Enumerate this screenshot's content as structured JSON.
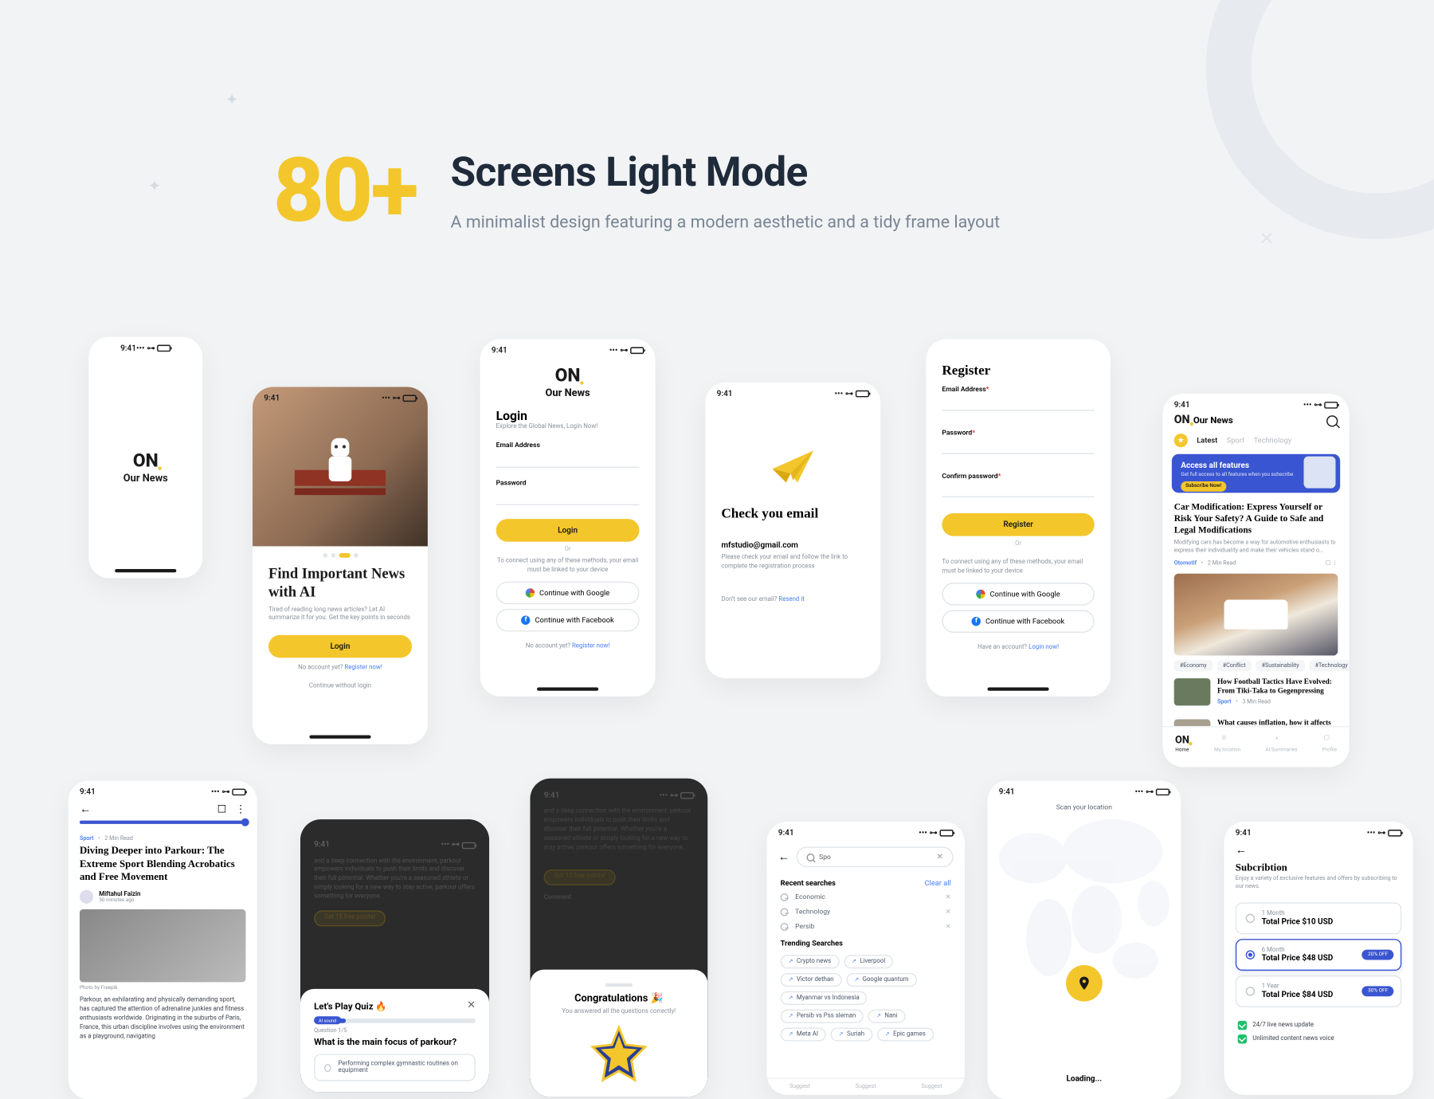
{
  "hero": {
    "number": "80+",
    "title": "Screens Light Mode",
    "subtitle": "A minimalist design featuring a modern aesthetic and a tidy frame layout"
  },
  "status_time": "9:41",
  "brand": {
    "logo": "ON",
    "name": "Our News"
  },
  "screen_onboarding": {
    "title": "Find Important News with AI",
    "desc": "Tired of reading long news articles? Let AI summarize it for you. Get the key points in seconds",
    "cta": "Login",
    "no_account": "No account yet? ",
    "register": "Register now!",
    "skip": "Continue without login"
  },
  "screen_login": {
    "title": "Login",
    "subtitle": "Explore the Global News, Login Now!",
    "email_label": "Email Address",
    "password_label": "Password",
    "cta": "Login",
    "or": "Or",
    "connect": "To connect using any of these methods, your email must be linked to your device",
    "google": "Continue with Google",
    "facebook": "Continue with Facebook",
    "no_account": "No account yet? ",
    "register": "Register now!"
  },
  "screen_check_email": {
    "title": "Check you email",
    "email": "mfstudio@gmail.com",
    "desc": "Please check your email and follow the link to complete the registration process",
    "no_email": "Don't see our email? ",
    "resend": "Resend it"
  },
  "screen_register": {
    "title": "Register",
    "email_label": "Email Address",
    "password_label": "Password",
    "confirm_label": "Confirm password",
    "cta": "Register",
    "or": "Or",
    "connect": "To connect using any of these methods, your email must be linked to your device",
    "google": "Continue with Google",
    "facebook": "Continue with Facebook",
    "have_account": "Have an account? ",
    "login": "Login now!"
  },
  "screen_home": {
    "tabs": [
      "Latest",
      "Sport",
      "Technology"
    ],
    "promo": {
      "title": "Access all features",
      "sub": "Get full access to all features when you subscribe",
      "cta": "Subscribe Now!"
    },
    "article1": {
      "title": "Car Modification: Express Yourself or Risk Your Safety? A Guide to Safe and Legal Modifications",
      "desc": "Modifying cars has become a way for automotive enthusiasts to express their individuality and make their vehicles stand o…",
      "cat": "Otomotif",
      "read": "2 Min Read"
    },
    "chips": [
      "#Economy",
      "#Conflict",
      "#Sustainability",
      "#Technology"
    ],
    "article2": {
      "title": "How Football Tactics Have Evolved: From Tiki-Taka to Gegenpressing",
      "cat": "Sport",
      "read": "3 Min Read"
    },
    "article3": {
      "title": "What causes inflation, how it affects the"
    },
    "nav": [
      "Home",
      "My location",
      "AI Summaries",
      "Profile"
    ]
  },
  "screen_article": {
    "cat": "Sport",
    "read": "2 Min Read",
    "title": "Diving Deeper into Parkour: The Extreme Sport Blending Acrobatics and Free Movement",
    "author": "Miftahul Faizin",
    "time": "30 minutes ago",
    "caption": "Photo by Freepik",
    "body": "Parkour, an exhilarating and physically demanding sport, has captured the attention of adrenaline junkies and fitness enthusiasts worldwide. Originating in the suburbs of Paris, France, this urban discipline involves using the environment as a playground, navigating"
  },
  "screen_quiz": {
    "offer": "Get 15 free points!",
    "faux": "and a deep connection with the environment, parkour empowers individuals to push their limits and discover their full potential. Whether you're a seasoned athlete or simply looking for a new way to stay active, parkour offers something for everyone.",
    "sheet_title": "Let's Play Quiz 🔥",
    "progress_badge": "AI sound",
    "q_count": "Question 1/5",
    "q_text": "What is the main focus of parkour?",
    "option1": "Performing complex gymnastic routines on equipment"
  },
  "screen_congrats": {
    "faux": "and a deep connection with the environment, parkour empowers individuals to push their limits and discover their full potential. Whether you're a seasoned athlete or simply looking for a new way to stay active, parkour offers something for everyone.",
    "offer": "Got 15 free points!",
    "comment": "Comment",
    "title": "Congratulations 🎉",
    "sub": "You answered all the questions correctly!"
  },
  "screen_search": {
    "query": "Spo",
    "recent_title": "Recent searches",
    "clear": "Clear all",
    "recent": [
      "Economic",
      "Technology",
      "Persib"
    ],
    "trending_title": "Trending Searches",
    "trending": [
      "Crypto news",
      "Liverpool",
      "Victor dethan",
      "Google quantum",
      "Myanmar vs Indonesia",
      "Persib vs Pss sleman",
      "Nani",
      "Meta AI",
      "Suriah",
      "Epic games"
    ],
    "segments": [
      "Suggest",
      "Suggest",
      "Suggest"
    ]
  },
  "screen_location": {
    "scan": "Scan your location",
    "loading": "Loading..."
  },
  "screen_subscription": {
    "title": "Subcribtion",
    "desc": "Enjoy a variety of exclusive features and offers by subscribing to our news.",
    "plans": [
      {
        "duration": "1 Month",
        "price": "Total Price $10 USD"
      },
      {
        "duration": "6 Month",
        "price": "Total Price $48 USD",
        "off": "20% OFF"
      },
      {
        "duration": "1 Year",
        "price": "Total Price $84 USD",
        "off": "30% OFF"
      }
    ],
    "features": [
      "24/7 live news update",
      "Unlimited content news voice"
    ]
  }
}
